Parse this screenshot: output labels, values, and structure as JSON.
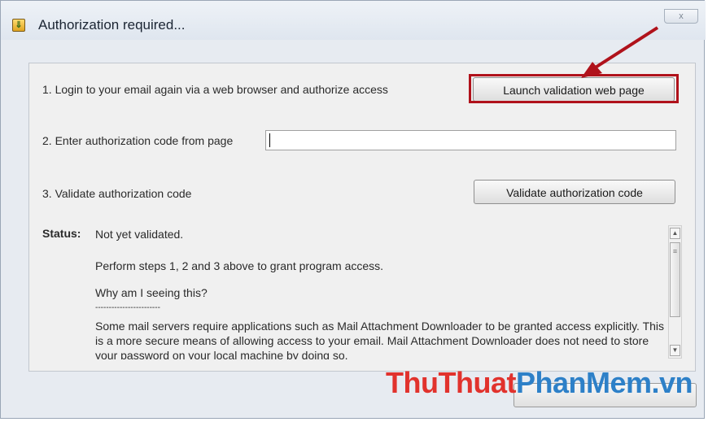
{
  "window": {
    "title": "Authorization required...",
    "close_glyph": "x",
    "app_icon": "download-icon"
  },
  "steps": [
    {
      "text": "1. Login to your email again via a web browser and authorize access",
      "button": "Launch validation web page"
    },
    {
      "text": "2. Enter authorization code from page",
      "input_value": ""
    },
    {
      "text": "3. Validate authorization code",
      "button": "Validate authorization code"
    }
  ],
  "status": {
    "label": "Status:",
    "value": "Not yet validated.",
    "instruction": "Perform steps 1, 2 and 3 above to grant program access.",
    "question": "Why am I seeing this?",
    "separator": "------------------------",
    "explanation": "Some mail servers require applications such as Mail Attachment Downloader to be granted access explicitly. This is a more secure means of allowing access to your email. Mail Attachment Downloader does not need to store your password on your local machine by doing so."
  },
  "watermark": {
    "part1": "Thu",
    "part2": "Thuat",
    "part3": "PhanMem",
    "part4": ".vn"
  },
  "colors": {
    "highlight": "#b0121b",
    "arrow": "#b0121b"
  }
}
